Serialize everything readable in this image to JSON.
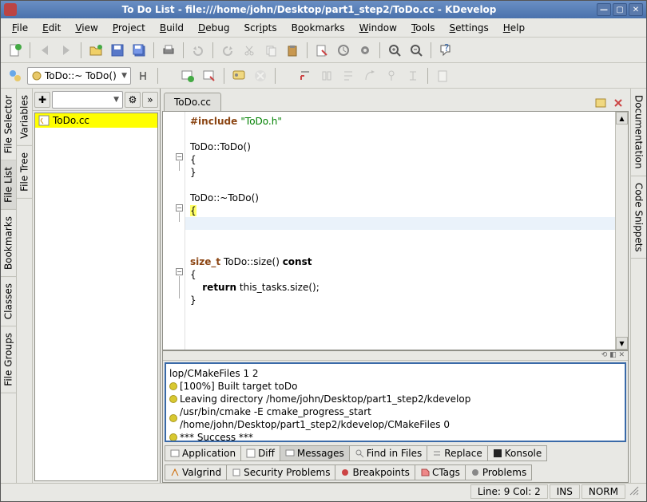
{
  "window": {
    "title": "To Do List - file:///home/john/Desktop/part1_step2/ToDo.cc - KDevelop"
  },
  "menubar": [
    "File",
    "Edit",
    "View",
    "Project",
    "Build",
    "Debug",
    "Scripts",
    "Bookmarks",
    "Window",
    "Tools",
    "Settings",
    "Help"
  ],
  "class_dropdown": "ToDo::~ ToDo()",
  "left_tabs_outer": [
    "File Selector",
    "File List",
    "Bookmarks",
    "Classes",
    "File Groups"
  ],
  "left_tabs_inner": [
    "Variables",
    "File Tree"
  ],
  "right_tabs": [
    "Documentation",
    "Code Snippets"
  ],
  "file_panel": {
    "items": [
      "ToDo.cc"
    ]
  },
  "editor": {
    "tab": "ToDo.cc",
    "lines": {
      "l1": "#include \"ToDo.h\"",
      "l3a": "ToDo::ToDo()",
      "l7a": "ToDo::~ToDo()",
      "l12a": "size_t",
      "l12b": " ToDo::size() ",
      "l12c": "const",
      "l14a": "return",
      "l14b": " this_tasks.size();"
    }
  },
  "messages": [
    "lop/CMakeFiles 1 2",
    "[100%] Built target toDo",
    "Leaving directory /home/john/Desktop/part1_step2/kdevelop",
    "/usr/bin/cmake -E cmake_progress_start /home/john/Desktop/part1_step2/kdevelop/CMakeFiles 0",
    "*** Success ***"
  ],
  "bottom_tabs_row1": [
    "Application",
    "Diff",
    "Messages",
    "Find in Files",
    "Replace",
    "Konsole"
  ],
  "bottom_tabs_row2": [
    "Valgrind",
    "Security Problems",
    "Breakpoints",
    "CTags",
    "Problems"
  ],
  "status": {
    "pos": "Line: 9 Col: 2",
    "ins": "INS",
    "mode": "NORM"
  }
}
